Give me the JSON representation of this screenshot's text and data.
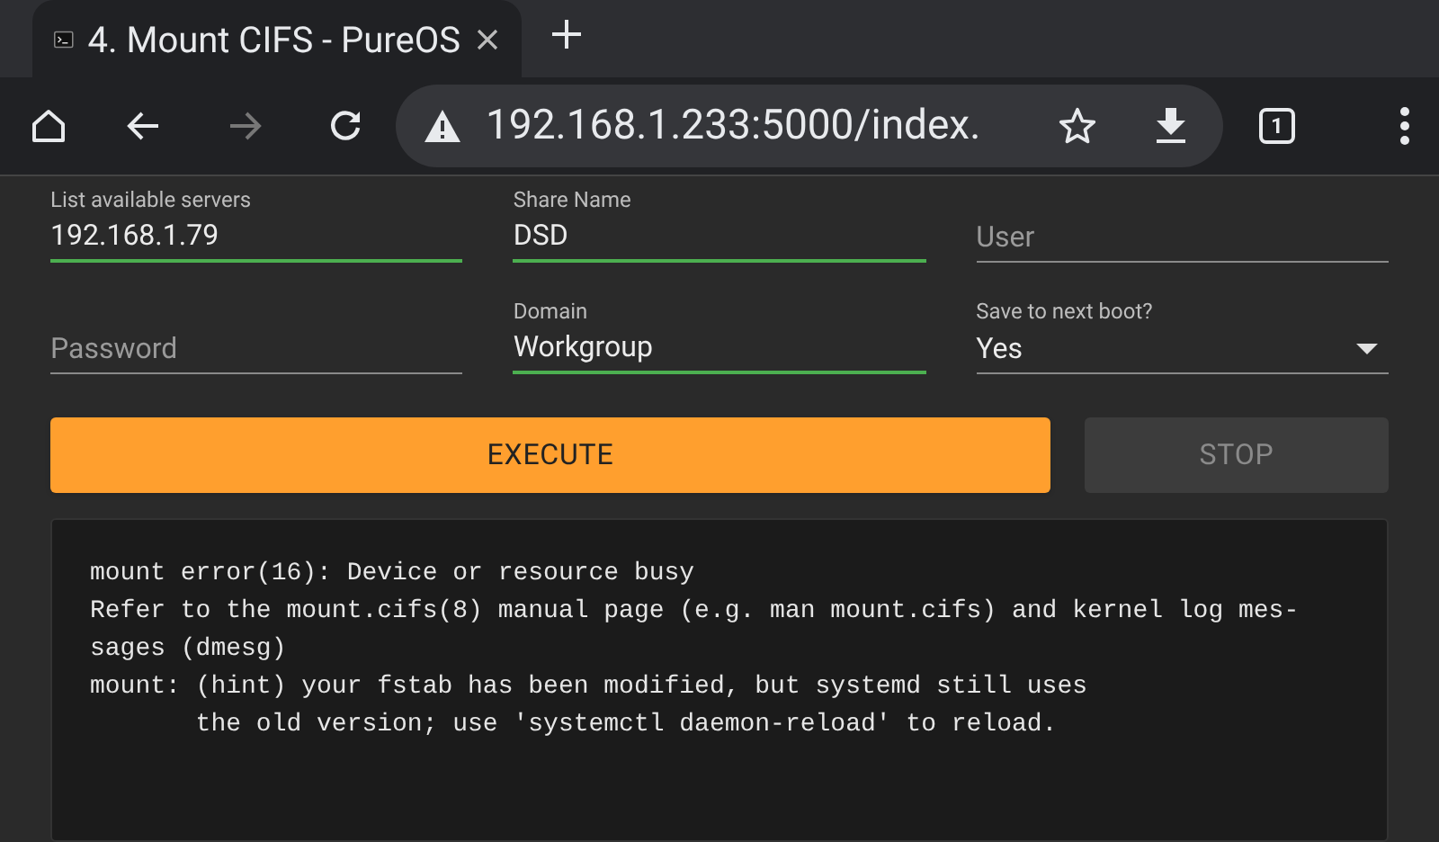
{
  "browser": {
    "tabs": [
      {
        "title": "4. Mount CIFS - PureOS",
        "selected": true
      }
    ],
    "address": "192.168.1.233:5000/index.",
    "tab_count": "1"
  },
  "form": {
    "fields": [
      {
        "kind": "text",
        "label": "List available servers",
        "value": "192.168.1.79",
        "highlighted": true
      },
      {
        "kind": "text",
        "label": "Share Name",
        "value": "DSD",
        "highlighted": true
      },
      {
        "kind": "text",
        "placeholder": "User",
        "highlighted": false
      },
      {
        "kind": "text",
        "placeholder": "Password",
        "highlighted": false
      },
      {
        "kind": "text",
        "label": "Domain",
        "value": "Workgroup",
        "highlighted": true
      },
      {
        "kind": "select",
        "label": "Save to next boot?",
        "value": "Yes",
        "highlighted": false
      }
    ]
  },
  "buttons": [
    {
      "label": "EXECUTE",
      "disabled": false
    },
    {
      "label": "STOP",
      "disabled": true
    }
  ],
  "console": {
    "lines": [
      "mount error(16): Device or resource busy",
      "Refer to the mount.cifs(8) manual page (e.g. man mount.cifs) and kernel log mes-",
      "sages (dmesg)",
      "mount: (hint) your fstab has been modified, but systemd still uses",
      "       the old version; use 'systemctl daemon-reload' to reload."
    ]
  }
}
